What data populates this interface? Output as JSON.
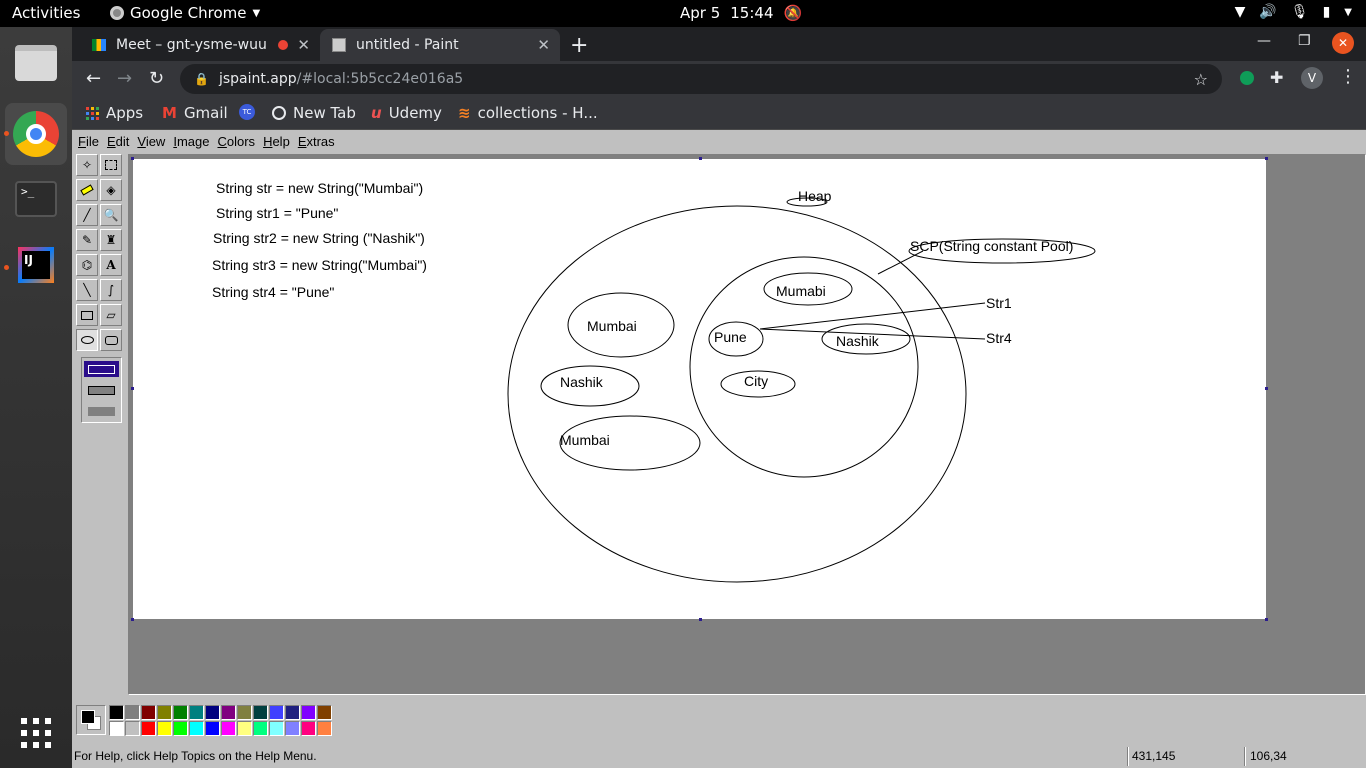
{
  "topbar": {
    "activities": "Activities",
    "app_name": "Google Chrome",
    "date": "Apr 5",
    "time": "15:44"
  },
  "browser": {
    "tabs": [
      {
        "title": "Meet – gnt-ysme-wuu"
      },
      {
        "title": "untitled - Paint"
      }
    ],
    "url_host": "jspaint.app",
    "url_rest": "/#local:5b5cc24e016a5",
    "profile_initial": "V",
    "bookmarks": [
      {
        "label": "Apps"
      },
      {
        "label": "Gmail"
      },
      {
        "label": ""
      },
      {
        "label": "New Tab"
      },
      {
        "label": "Udemy"
      },
      {
        "label": "collections - H..."
      }
    ]
  },
  "paint": {
    "menus": [
      "File",
      "Edit",
      "View",
      "Image",
      "Colors",
      "Help",
      "Extras"
    ],
    "canvas_text": {
      "code_lines": [
        "String str = new String(\"Mumbai\")",
        "String str1 = \"Pune\"",
        "String str2 = new String (\"Nashik\")",
        "String str3 = new String(\"Mumbai\")",
        "String str4 = \"Pune\""
      ],
      "heap": "Heap",
      "scp": "SCP(String constant Pool)",
      "heap_items": [
        "Mumbai",
        "Nashik",
        "Mumbai"
      ],
      "pool_items": [
        "Mumabi",
        "Pune",
        "Nashik",
        "City"
      ],
      "ref_str1": "Str1",
      "ref_str4": "Str4"
    },
    "palette": {
      "row1": [
        "#000000",
        "#808080",
        "#800000",
        "#808000",
        "#008000",
        "#008080",
        "#000080",
        "#800080",
        "#808040",
        "#004040",
        "#4040ff",
        "#202080",
        "#8000ff",
        "#804000"
      ],
      "row2": [
        "#ffffff",
        "#c0c0c0",
        "#ff0000",
        "#ffff00",
        "#00ff00",
        "#00ffff",
        "#0000ff",
        "#ff00ff",
        "#ffff80",
        "#00ff80",
        "#80ffff",
        "#8080ff",
        "#ff0080",
        "#ff8040"
      ]
    },
    "status": {
      "help": "For Help, click Help Topics on the Help Menu.",
      "cursor_pos": "431,145",
      "selection_size": "106,34"
    }
  }
}
